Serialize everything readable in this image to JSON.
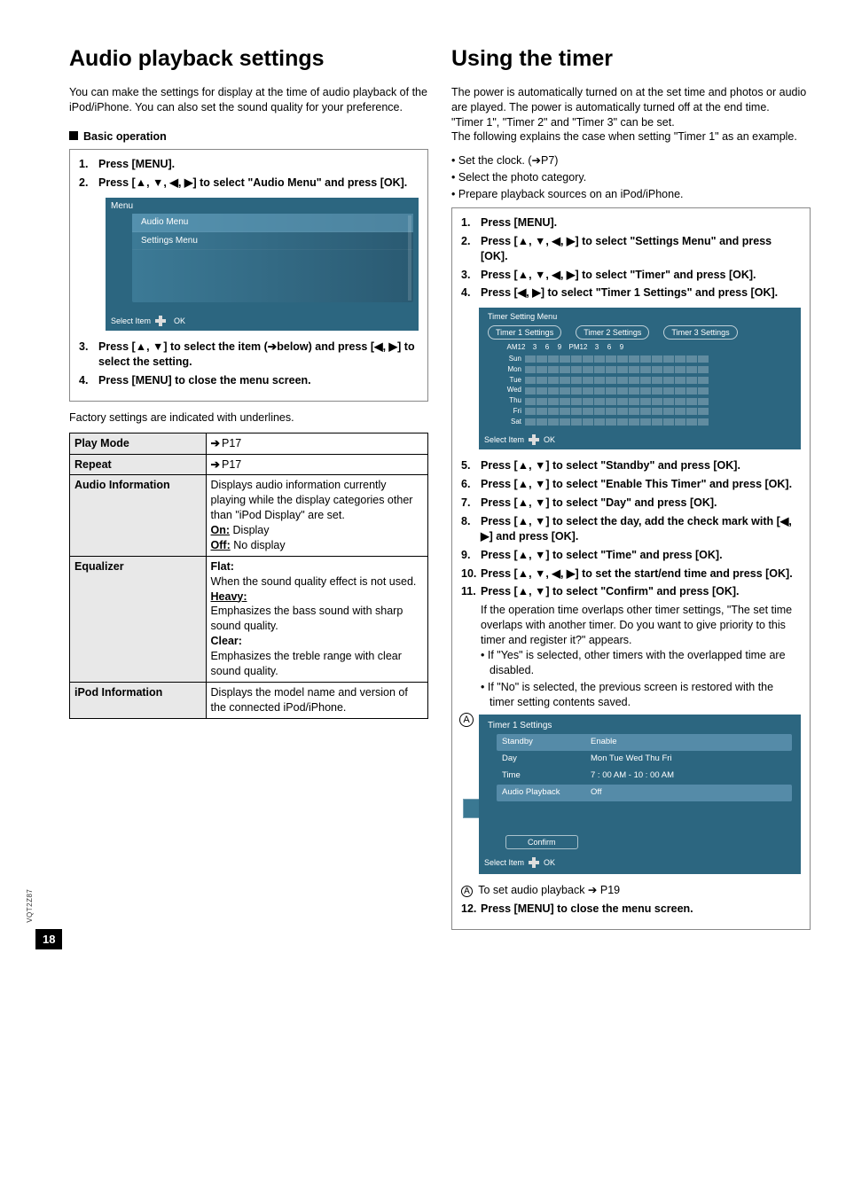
{
  "page_number": "18",
  "side_code": "VQT2Z87",
  "left": {
    "heading": "Audio playback settings",
    "intro": "You can make the settings for display at the time of audio playback of the iPod/iPhone. You can also set the sound quality for your preference.",
    "basic_op_label": "Basic operation",
    "steps": {
      "s1": "Press [MENU].",
      "s2": "Press [▲, ▼, ◀, ▶] to select \"Audio Menu\" and press [OK].",
      "s3": "Press [▲, ▼] to select the item (➔below) and press [◀, ▶] to select the setting.",
      "s4": "Press [MENU] to close the menu screen."
    },
    "menu_fig": {
      "title": "Menu",
      "row1": "Audio Menu",
      "row2": "Settings Menu",
      "select_item": "Select Item",
      "ok": "OK"
    },
    "factory_note": "Factory settings are indicated with underlines.",
    "table": {
      "r1c1": "Play Mode",
      "r1c2": "P17",
      "r2c1": "Repeat",
      "r2c2": "P17",
      "r3c1": "Audio Information",
      "r3c2_a": "Displays audio information currently playing while the display categories other than \"iPod Display\" are set.",
      "r3c2_on": "On:",
      "r3c2_on_v": " Display",
      "r3c2_off": "Off:",
      "r3c2_off_v": " No display",
      "r4c1": "Equalizer",
      "r4_flat": "Flat:",
      "r4_flat_d": "When the sound quality effect is not used.",
      "r4_heavy": "Heavy:",
      "r4_heavy_d": "Emphasizes the bass sound with sharp sound quality.",
      "r4_clear": "Clear:",
      "r4_clear_d": "Emphasizes the treble range with clear sound quality.",
      "r5c1": "iPod Information",
      "r5c2": "Displays the model name and version of the connected iPod/iPhone."
    }
  },
  "right": {
    "heading": "Using the timer",
    "intro1": "The power is automatically turned on at the set time and photos or audio are played. The power is automatically turned off at the end time.",
    "intro2": "\"Timer 1\", \"Timer 2\" and \"Timer 3\" can be set.",
    "intro3": "The following explains the case when setting \"Timer 1\" as an example.",
    "pre": {
      "b1": "Set the clock. (➔P7)",
      "b2": "Select the photo category.",
      "b3": "Prepare playback sources on an iPod/iPhone."
    },
    "steps": {
      "s1": "Press [MENU].",
      "s2": "Press [▲, ▼, ◀, ▶] to select \"Settings Menu\" and press [OK].",
      "s3": "Press [▲, ▼, ◀, ▶] to select \"Timer\" and press [OK].",
      "s4": "Press [◀, ▶] to select \"Timer 1 Settings\" and press [OK].",
      "s5": "Press [▲, ▼] to select \"Standby\" and press [OK].",
      "s6": "Press [▲, ▼] to select \"Enable This Timer\" and press [OK].",
      "s7": "Press [▲, ▼] to select \"Day\" and press [OK].",
      "s8": "Press [▲, ▼] to select the day, add the check mark with [◀, ▶] and press [OK].",
      "s9": "Press [▲, ▼] to select \"Time\" and press [OK].",
      "s10": "Press [▲, ▼, ◀, ▶] to set the start/end time and press [OK].",
      "s11": "Press [▲, ▼] to select \"Confirm\" and press [OK].",
      "s11_a": "If the operation time overlaps other timer settings, \"The set time overlaps with another timer. Do you want to give priority to this timer and register it?\" appears.",
      "s11_b": "If \"Yes\" is selected, other timers with the overlapped time are disabled.",
      "s11_c": "If \"No\" is selected, the previous screen is restored with the timer setting contents saved.",
      "s12": "Press [MENU] to close the menu screen."
    },
    "timerfig": {
      "title": "Timer Setting Menu",
      "tab1": "Timer 1 Settings",
      "tab2": "Timer 2 Settings",
      "tab3": "Timer 3 Settings",
      "am": "AM12",
      "pm": "PM12",
      "h": [
        "3",
        "6",
        "9",
        "3",
        "6",
        "9"
      ],
      "days": [
        "Sun",
        "Mon",
        "Tue",
        "Wed",
        "Thu",
        "Fri",
        "Sat"
      ],
      "select_item": "Select Item",
      "ok": "OK"
    },
    "t1fig": {
      "circ": "A",
      "title": "Timer 1 Settings",
      "rows": {
        "standby_l": "Standby",
        "standby_v": "Enable",
        "day_l": "Day",
        "day_v": "Mon Tue  Wed  Thu  Fri",
        "time_l": "Time",
        "time_v": "7 : 00 AM  -  10 : 00 AM",
        "audio_l": "Audio Playback",
        "audio_v": "Off"
      },
      "confirm": "Confirm",
      "select_item": "Select Item",
      "ok": "OK"
    },
    "footnote": " To set audio playback ➔ P19"
  }
}
